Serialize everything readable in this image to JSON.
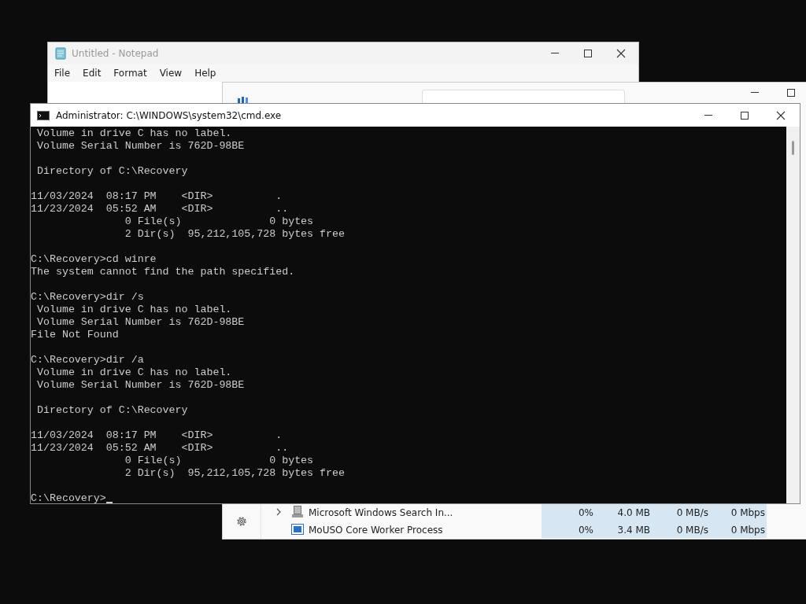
{
  "notepad": {
    "title": "Untitled - Notepad",
    "menu": [
      "File",
      "Edit",
      "Format",
      "View",
      "Help"
    ]
  },
  "task_manager": {
    "processes": [
      {
        "name": "Microsoft Windows Search In...",
        "expandable": true,
        "cpu": "0%",
        "memory": "4.0 MB",
        "disk": "0 MB/s",
        "network": "0 Mbps"
      },
      {
        "name": "MoUSO Core Worker Process",
        "expandable": false,
        "cpu": "0%",
        "memory": "3.4 MB",
        "disk": "0 MB/s",
        "network": "0 Mbps"
      }
    ]
  },
  "cmd": {
    "title": "Administrator: C:\\WINDOWS\\system32\\cmd.exe",
    "output_blocks": [
      [
        " Volume in drive C has no label.",
        " Volume Serial Number is 762D-98BE"
      ],
      [
        " Directory of C:\\Recovery"
      ],
      [
        "11/03/2024  08:17 PM    <DIR>          .",
        "11/23/2024  05:52 AM    <DIR>          ..",
        "               0 File(s)              0 bytes",
        "               2 Dir(s)  95,212,105,728 bytes free"
      ],
      [
        "C:\\Recovery>cd winre",
        "The system cannot find the path specified."
      ],
      [
        "C:\\Recovery>dir /s",
        " Volume in drive C has no label.",
        " Volume Serial Number is 762D-98BE",
        "File Not Found"
      ],
      [
        "C:\\Recovery>dir /a",
        " Volume in drive C has no label.",
        " Volume Serial Number is 762D-98BE"
      ],
      [
        " Directory of C:\\Recovery"
      ],
      [
        "11/03/2024  08:17 PM    <DIR>          .",
        "11/23/2024  05:52 AM    <DIR>          ..",
        "               0 File(s)              0 bytes",
        "               2 Dir(s)  95,212,105,728 bytes free"
      ]
    ],
    "prompt": "C:\\Recovery>"
  }
}
